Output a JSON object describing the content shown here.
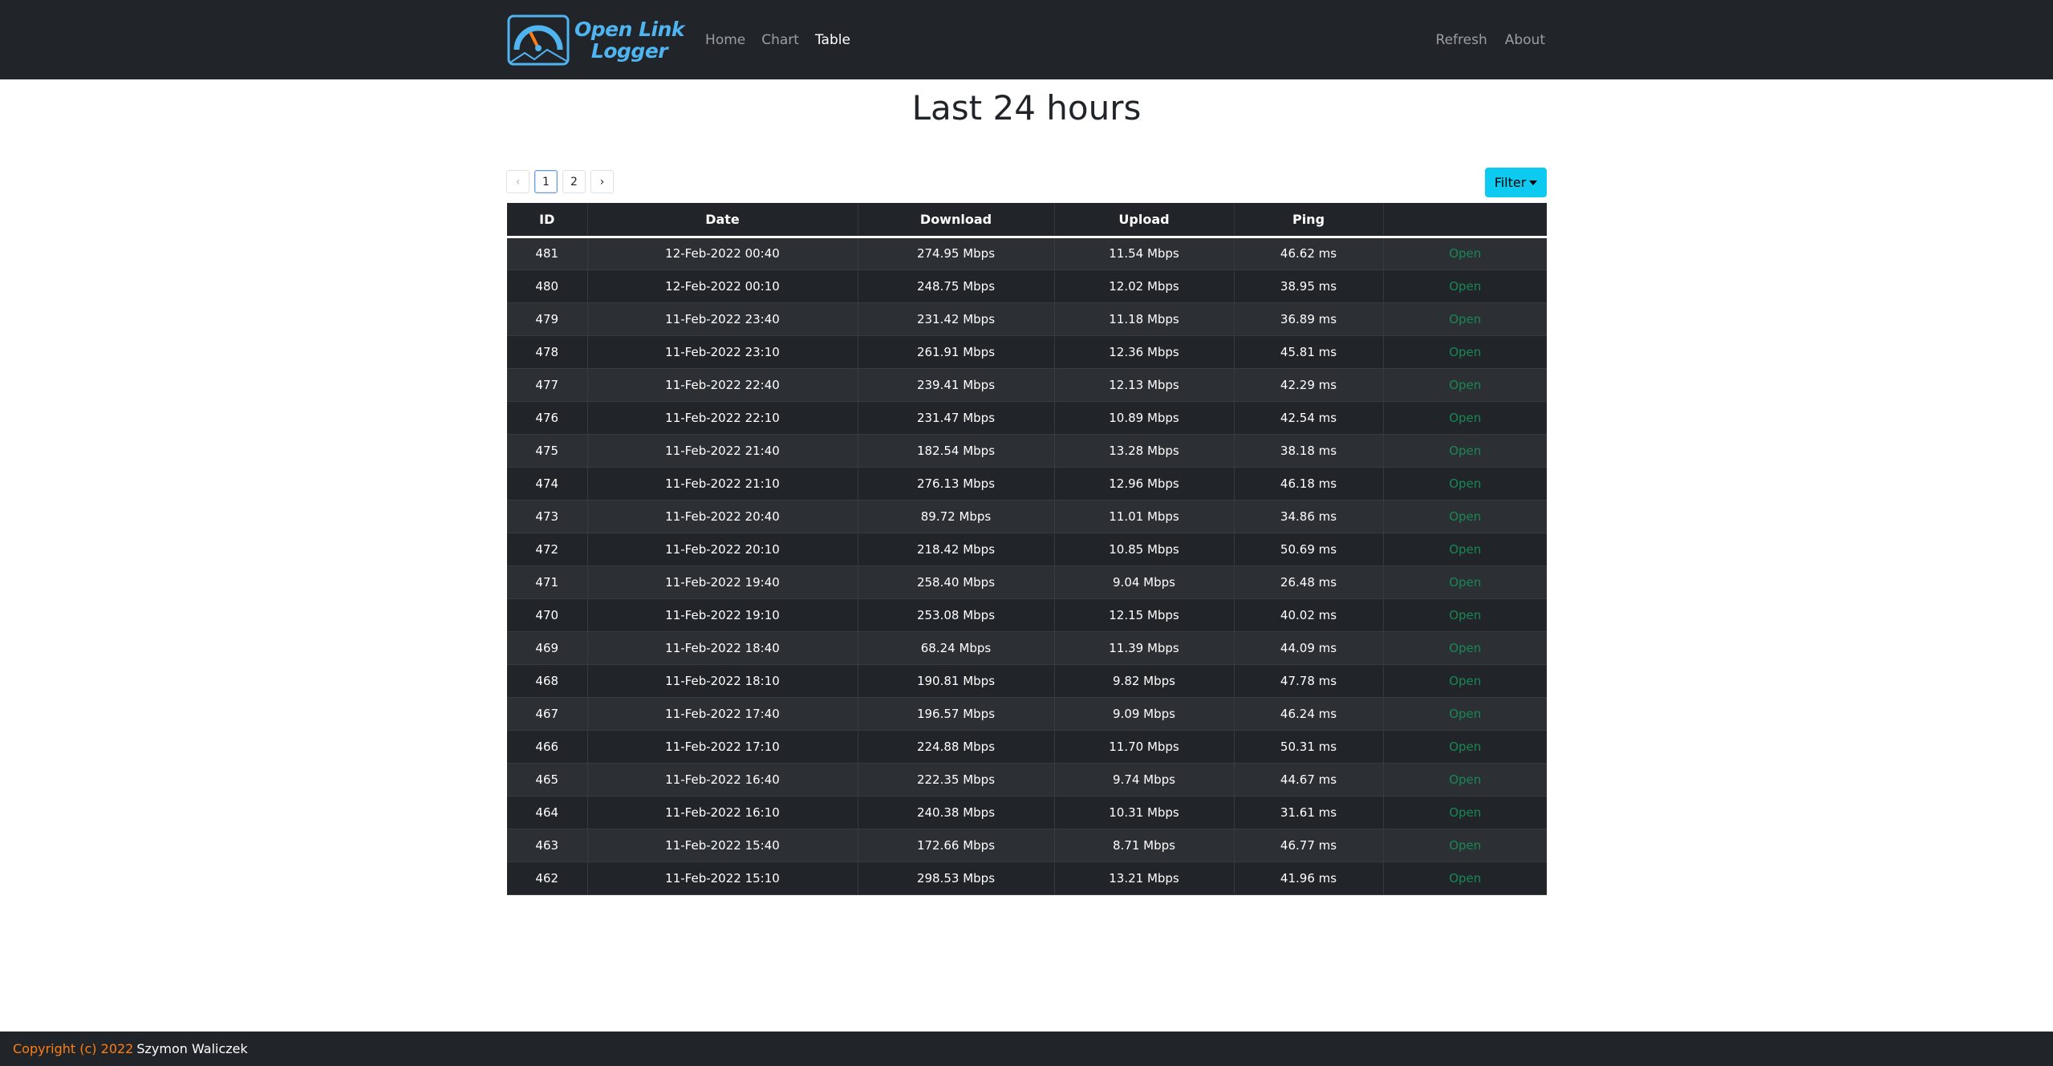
{
  "app": {
    "logo_line1": "Open Link",
    "logo_line2": "Logger",
    "logo_icon": "speedometer-icon"
  },
  "nav": {
    "home": "Home",
    "chart": "Chart",
    "table": "Table",
    "refresh": "Refresh",
    "about": "About"
  },
  "page": {
    "title": "Last 24 hours"
  },
  "pagination": {
    "prev": "‹",
    "pages": [
      "1",
      "2"
    ],
    "next": "›",
    "active_page": "1"
  },
  "filter": {
    "label": "Filter"
  },
  "table": {
    "headers": [
      "ID",
      "Date",
      "Download",
      "Upload",
      "Ping",
      ""
    ],
    "open_label": "Open",
    "rows": [
      [
        "481",
        "12-Feb-2022 00:40",
        "274.95 Mbps",
        "11.54 Mbps",
        "46.62 ms"
      ],
      [
        "480",
        "12-Feb-2022 00:10",
        "248.75 Mbps",
        "12.02 Mbps",
        "38.95 ms"
      ],
      [
        "479",
        "11-Feb-2022 23:40",
        "231.42 Mbps",
        "11.18 Mbps",
        "36.89 ms"
      ],
      [
        "478",
        "11-Feb-2022 23:10",
        "261.91 Mbps",
        "12.36 Mbps",
        "45.81 ms"
      ],
      [
        "477",
        "11-Feb-2022 22:40",
        "239.41 Mbps",
        "12.13 Mbps",
        "42.29 ms"
      ],
      [
        "476",
        "11-Feb-2022 22:10",
        "231.47 Mbps",
        "10.89 Mbps",
        "42.54 ms"
      ],
      [
        "475",
        "11-Feb-2022 21:40",
        "182.54 Mbps",
        "13.28 Mbps",
        "38.18 ms"
      ],
      [
        "474",
        "11-Feb-2022 21:10",
        "276.13 Mbps",
        "12.96 Mbps",
        "46.18 ms"
      ],
      [
        "473",
        "11-Feb-2022 20:40",
        "89.72 Mbps",
        "11.01 Mbps",
        "34.86 ms"
      ],
      [
        "472",
        "11-Feb-2022 20:10",
        "218.42 Mbps",
        "10.85 Mbps",
        "50.69 ms"
      ],
      [
        "471",
        "11-Feb-2022 19:40",
        "258.40 Mbps",
        "9.04 Mbps",
        "26.48 ms"
      ],
      [
        "470",
        "11-Feb-2022 19:10",
        "253.08 Mbps",
        "12.15 Mbps",
        "40.02 ms"
      ],
      [
        "469",
        "11-Feb-2022 18:40",
        "68.24 Mbps",
        "11.39 Mbps",
        "44.09 ms"
      ],
      [
        "468",
        "11-Feb-2022 18:10",
        "190.81 Mbps",
        "9.82 Mbps",
        "47.78 ms"
      ],
      [
        "467",
        "11-Feb-2022 17:40",
        "196.57 Mbps",
        "9.09 Mbps",
        "46.24 ms"
      ],
      [
        "466",
        "11-Feb-2022 17:10",
        "224.88 Mbps",
        "11.70 Mbps",
        "50.31 ms"
      ],
      [
        "465",
        "11-Feb-2022 16:40",
        "222.35 Mbps",
        "9.74 Mbps",
        "44.67 ms"
      ],
      [
        "464",
        "11-Feb-2022 16:10",
        "240.38 Mbps",
        "10.31 Mbps",
        "31.61 ms"
      ],
      [
        "463",
        "11-Feb-2022 15:40",
        "172.66 Mbps",
        "8.71 Mbps",
        "46.77 ms"
      ],
      [
        "462",
        "11-Feb-2022 15:10",
        "298.53 Mbps",
        "13.21 Mbps",
        "41.96 ms"
      ]
    ]
  },
  "footer": {
    "copyright": "Copyright (c) 2022",
    "author": "Szymon Waliczek"
  },
  "colors": {
    "navbar_bg": "#212529",
    "logo_blue": "#4fb4f0",
    "filter_btn": "#0dcaf0",
    "open_link": "#198754",
    "copyright": "#fd7e14"
  }
}
